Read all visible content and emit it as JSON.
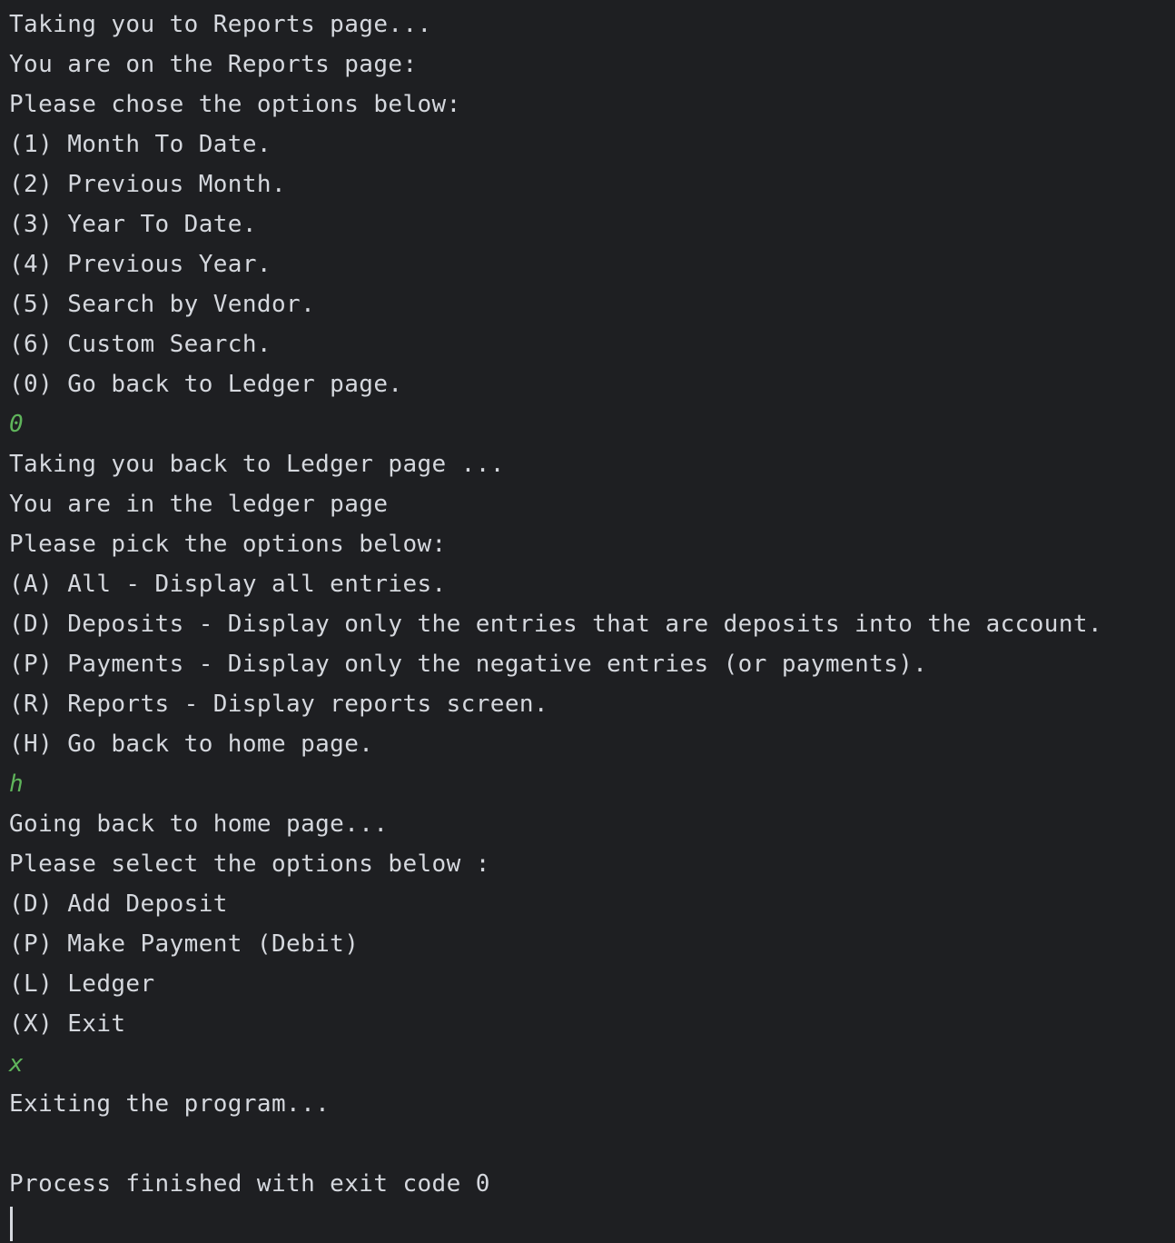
{
  "colors": {
    "background": "#1e1f22",
    "output_text": "#d5d8de",
    "user_input": "#5fb45b"
  },
  "console": {
    "lines": [
      {
        "text": "Taking you to Reports page...",
        "kind": "output"
      },
      {
        "text": "You are on the Reports page:",
        "kind": "output"
      },
      {
        "text": "Please chose the options below:",
        "kind": "output"
      },
      {
        "text": "(1) Month To Date.",
        "kind": "output"
      },
      {
        "text": "(2) Previous Month.",
        "kind": "output"
      },
      {
        "text": "(3) Year To Date.",
        "kind": "output"
      },
      {
        "text": "(4) Previous Year.",
        "kind": "output"
      },
      {
        "text": "(5) Search by Vendor.",
        "kind": "output"
      },
      {
        "text": "(6) Custom Search.",
        "kind": "output"
      },
      {
        "text": "(0) Go back to Ledger page.",
        "kind": "output"
      },
      {
        "text": "0",
        "kind": "input"
      },
      {
        "text": "Taking you back to Ledger page ...",
        "kind": "output"
      },
      {
        "text": "You are in the ledger page",
        "kind": "output"
      },
      {
        "text": "Please pick the options below:",
        "kind": "output"
      },
      {
        "text": "(A) All - Display all entries.",
        "kind": "output"
      },
      {
        "text": "(D) Deposits - Display only the entries that are deposits into the account.",
        "kind": "output"
      },
      {
        "text": "(P) Payments - Display only the negative entries (or payments).",
        "kind": "output"
      },
      {
        "text": "(R) Reports - Display reports screen.",
        "kind": "output"
      },
      {
        "text": "(H) Go back to home page.",
        "kind": "output"
      },
      {
        "text": "h",
        "kind": "input"
      },
      {
        "text": "Going back to home page...",
        "kind": "output"
      },
      {
        "text": "Please select the options below :",
        "kind": "output"
      },
      {
        "text": "(D) Add Deposit",
        "kind": "output"
      },
      {
        "text": "(P) Make Payment (Debit)",
        "kind": "output"
      },
      {
        "text": "(L) Ledger",
        "kind": "output"
      },
      {
        "text": "(X) Exit",
        "kind": "output"
      },
      {
        "text": "x",
        "kind": "input"
      },
      {
        "text": "Exiting the program...",
        "kind": "output"
      },
      {
        "text": "",
        "kind": "output"
      },
      {
        "text": "Process finished with exit code 0",
        "kind": "output"
      }
    ]
  }
}
